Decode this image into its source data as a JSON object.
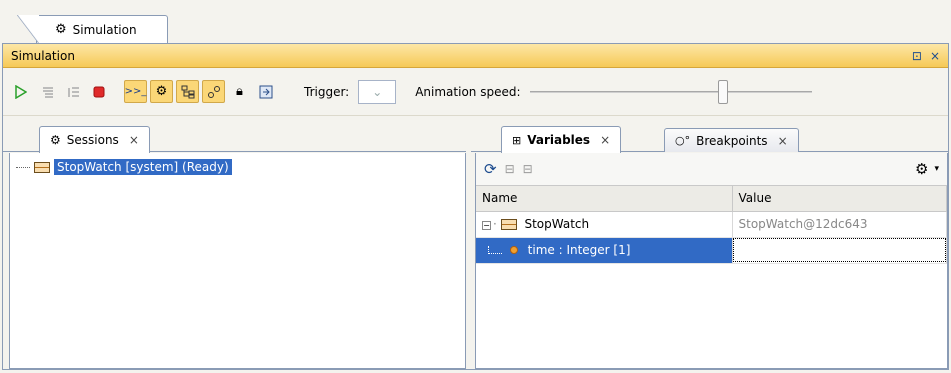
{
  "outer_tab": {
    "label": "Simulation"
  },
  "window": {
    "title": "Simulation",
    "controls": {
      "restore": "⊡",
      "close": "×"
    }
  },
  "toolbar": {
    "trigger_label": "Trigger:",
    "trigger_value": "⌄",
    "animation_speed_label": "Animation speed:",
    "animation_speed_level": 0.69
  },
  "sessions": {
    "tab_label": "Sessions",
    "tab_close": "×",
    "items": [
      {
        "label": "StopWatch [system] (Ready)"
      }
    ]
  },
  "variables": {
    "tab_label": "Variables",
    "tab_close": "×",
    "breakpoints_label": "Breakpoints",
    "breakpoints_close": "×",
    "columns": [
      "Name",
      "Value"
    ],
    "rows": [
      {
        "name": "StopWatch",
        "value": "StopWatch@12dc643",
        "expander": "⊟"
      },
      {
        "name": "time : Integer [1]",
        "value": ""
      }
    ]
  },
  "colors": {
    "accent": "#316ac5",
    "titlebar": "#f6c957",
    "active_button": "#fbd777"
  }
}
